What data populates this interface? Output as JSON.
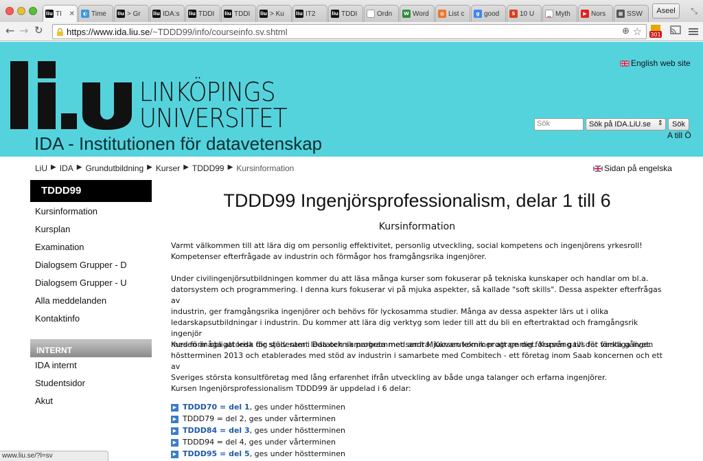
{
  "browser": {
    "tabs": [
      {
        "title": "TI",
        "favicon": "liu",
        "active": true
      },
      {
        "title": "Time",
        "favicon": "globe"
      },
      {
        "title": "> Gr",
        "favicon": "liu"
      },
      {
        "title": "IDA:s",
        "favicon": "liu"
      },
      {
        "title": "TDDI",
        "favicon": "liu"
      },
      {
        "title": "TDDI",
        "favicon": "liu"
      },
      {
        "title": "> Ku",
        "favicon": "liu"
      },
      {
        "title": "IT2",
        "favicon": "liu"
      },
      {
        "title": "TDDI",
        "favicon": "liu"
      },
      {
        "title": "Ordn",
        "favicon": "document"
      },
      {
        "title": "Word",
        "favicon": "w"
      },
      {
        "title": "List c",
        "favicon": "orange"
      },
      {
        "title": "good",
        "favicon": "google"
      },
      {
        "title": "10 U",
        "favicon": "s"
      },
      {
        "title": "Myth",
        "favicon": "chart"
      },
      {
        "title": "Nors",
        "favicon": "youtube"
      },
      {
        "title": "SSW",
        "favicon": "grid"
      }
    ],
    "user_button": "Aseel",
    "url_host": "https://www.ida.liu.se",
    "url_path": "/~TDDD99/info/courseinfo.sv.shtml",
    "extension_badge": "301",
    "status_url": "www.liu.se/?l=sv"
  },
  "header": {
    "university_line1": "LINKÖPINGS",
    "university_line2": "UNIVERSITET",
    "department": "IDA - Institutionen för datavetenskap",
    "english_link": "English web site",
    "search_placeholder": "Sök",
    "search_scope": "Sök på IDA.LiU.se",
    "search_button": "Sök",
    "a_till_o": "A till Ö"
  },
  "breadcrumb": [
    "LiU",
    "IDA",
    "Grundutbildning",
    "Kurser",
    "TDDD99",
    "Kursinformation"
  ],
  "sidan_link": "Sidan på engelska",
  "nav": {
    "header": "TDDD99",
    "items": [
      "Kursinformation",
      "Kursplan",
      "Examination",
      "Dialogsem Grupper - D",
      "Dialogsem Grupper - U",
      "Alla meddelanden",
      "Kontaktinfo"
    ],
    "internt_header": "INTERNT",
    "internt_items": [
      "IDA internt",
      "Studentsidor",
      "Akut"
    ]
  },
  "content": {
    "title": "TDDD99 Ingenjörsprofessionalism, delar 1 till 6",
    "section_title": "Kursinformation",
    "paragraphs": [
      [
        "Varmt välkommen till att lära dig om personlig effektivitet, personlig utveckling, social kompetens och ingenjörens yrkesroll!",
        "Kompetenser efterfrågade av industrin och förmågor hos framgångsrika ingenjörer."
      ],
      [
        "Under civilingenjörsutbildningen kommer du att läsa många kurser som fokuserar på tekniska kunskaper och handlar om bl.a.",
        "datorsystem och programmering. I denna kurs fokuserar vi på mjuka aspekter, så kallade \"soft skills\". Dessa aspekter efterfrågas av",
        "industrin, ger framgångsrika ingenjörer och behövs för lyckosamma studier. Många av dessa aspekter lärs ut i olika",
        "ledarskapsutbildningar i industrin. Du kommer att lära dig verktyg som leder till att du bli en eftertraktad och framgångsrik ingenjör",
        "med förmåga att leda dig själv samt leda och samarbeta med andra. Kursen kommer att ge dig försprång till det verkliga livet."
      ],
      [
        "Kursen är obligatorisk för studenter i Datateknik programmet samt Mjukvaruteknik programmet. Kursen gavs för första gången",
        "höstterminen 2013 och etablerades med stöd av industrin i samarbete med Combitech - ett företag inom Saab koncernen och ett av",
        "Sveriges största konsultföretag med lång erfarenhet ifrån utveckling av både unga talanger och erfarna ingenjörer."
      ],
      [
        "Kursen Ingenjörsprofessionalism TDDD99 är uppdelad i 6 delar:"
      ]
    ],
    "parts": [
      {
        "link": "TDDD70 = del 1",
        "rest": ", ges under höstterminen",
        "is_link": true
      },
      {
        "link": "TDDD79 = del 2",
        "rest": ", ges under vårterminen",
        "is_link": false
      },
      {
        "link": "TDDD84 = del 3",
        "rest": ", ges under höstterminen",
        "is_link": true
      },
      {
        "link": "TDDD94 = del 4",
        "rest": ", ges under vårterminen",
        "is_link": false
      },
      {
        "link": "TDDD95 = del 5",
        "rest": ", ges under höstterminen",
        "is_link": true
      }
    ]
  },
  "colors": {
    "header_bg": "#55d3dd",
    "link": "#1f5aa6",
    "nav_header": "#000000"
  }
}
